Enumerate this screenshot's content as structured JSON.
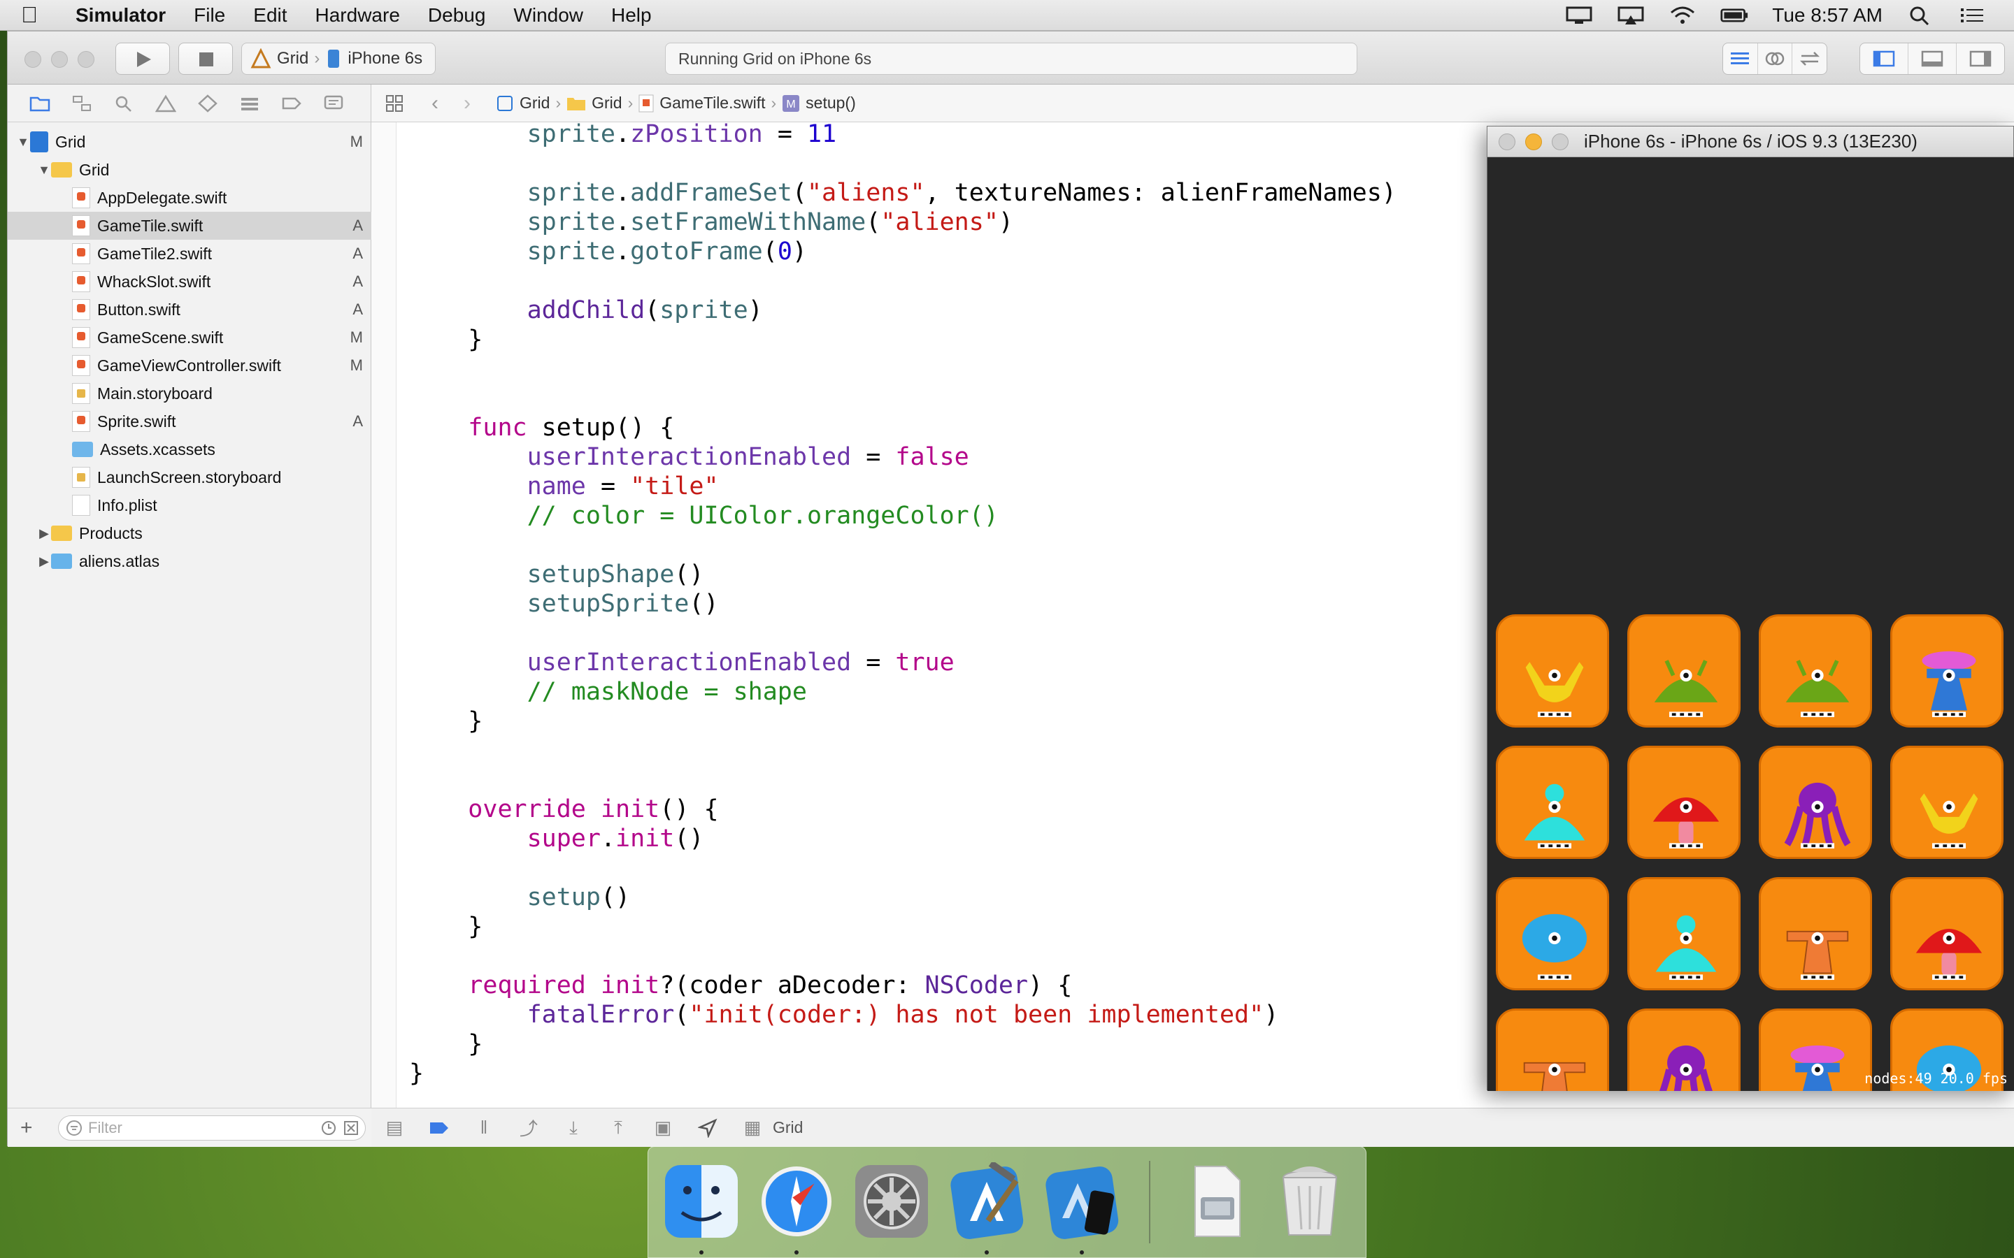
{
  "menubar": {
    "app_name": "Simulator",
    "items": [
      "File",
      "Edit",
      "Hardware",
      "Debug",
      "Window",
      "Help"
    ],
    "clock": "Tue 8:57 AM",
    "battery_icon": "battery-icon",
    "wifi_icon": "wifi-icon"
  },
  "xcode": {
    "scheme": {
      "target": "Grid",
      "device": "iPhone 6s"
    },
    "activity_status": "Running Grid on iPhone 6s",
    "jumpbar": [
      "Grid",
      "Grid",
      "GameTile.swift",
      "setup()"
    ],
    "navigator": {
      "items": [
        {
          "label": "Grid",
          "badge": "M",
          "kind": "project",
          "level": 0,
          "expanded": true
        },
        {
          "label": "Grid",
          "badge": "",
          "kind": "folder",
          "level": 1,
          "expanded": true
        },
        {
          "label": "AppDelegate.swift",
          "badge": "",
          "kind": "swift",
          "level": 2
        },
        {
          "label": "GameTile.swift",
          "badge": "A",
          "kind": "swift",
          "level": 2,
          "selected": true
        },
        {
          "label": "GameTile2.swift",
          "badge": "A",
          "kind": "swift",
          "level": 2
        },
        {
          "label": "WhackSlot.swift",
          "badge": "A",
          "kind": "swift",
          "level": 2
        },
        {
          "label": "Button.swift",
          "badge": "A",
          "kind": "swift",
          "level": 2
        },
        {
          "label": "GameScene.swift",
          "badge": "M",
          "kind": "swift",
          "level": 2
        },
        {
          "label": "GameViewController.swift",
          "badge": "M",
          "kind": "swift",
          "level": 2
        },
        {
          "label": "Main.storyboard",
          "badge": "",
          "kind": "storyboard",
          "level": 2
        },
        {
          "label": "Sprite.swift",
          "badge": "A",
          "kind": "swift",
          "level": 2
        },
        {
          "label": "Assets.xcassets",
          "badge": "",
          "kind": "assets",
          "level": 2
        },
        {
          "label": "LaunchScreen.storyboard",
          "badge": "",
          "kind": "storyboard",
          "level": 2
        },
        {
          "label": "Info.plist",
          "badge": "",
          "kind": "plist",
          "level": 2
        },
        {
          "label": "Products",
          "badge": "",
          "kind": "folder",
          "level": 1,
          "expanded": false
        },
        {
          "label": "aliens.atlas",
          "badge": "",
          "kind": "folder-blue",
          "level": 1,
          "expanded": false
        }
      ],
      "filter_placeholder": "Filter"
    },
    "code_lines": [
      [
        {
          "t": "        "
        },
        {
          "t": "sprite",
          "c": "fn"
        },
        {
          "t": "."
        },
        {
          "t": "zPosition",
          "c": "prop"
        },
        {
          "t": " = "
        },
        {
          "t": "11",
          "c": "num"
        }
      ],
      [],
      [
        {
          "t": "        "
        },
        {
          "t": "sprite",
          "c": "fn"
        },
        {
          "t": "."
        },
        {
          "t": "addFrameSet",
          "c": "fn"
        },
        {
          "t": "("
        },
        {
          "t": "\"aliens\"",
          "c": "str"
        },
        {
          "t": ", textureNames: alienFrameNames)"
        }
      ],
      [
        {
          "t": "        "
        },
        {
          "t": "sprite",
          "c": "fn"
        },
        {
          "t": "."
        },
        {
          "t": "setFrameWithName",
          "c": "fn"
        },
        {
          "t": "("
        },
        {
          "t": "\"aliens\"",
          "c": "str"
        },
        {
          "t": ")"
        }
      ],
      [
        {
          "t": "        "
        },
        {
          "t": "sprite",
          "c": "fn"
        },
        {
          "t": "."
        },
        {
          "t": "gotoFrame",
          "c": "fn"
        },
        {
          "t": "("
        },
        {
          "t": "0",
          "c": "num"
        },
        {
          "t": ")"
        }
      ],
      [],
      [
        {
          "t": "        "
        },
        {
          "t": "addChild",
          "c": "ty"
        },
        {
          "t": "("
        },
        {
          "t": "sprite",
          "c": "fn"
        },
        {
          "t": ")"
        }
      ],
      [
        {
          "t": "    }"
        }
      ],
      [],
      [],
      [
        {
          "t": "    "
        },
        {
          "t": "func",
          "c": "kw"
        },
        {
          "t": " setup() {"
        }
      ],
      [
        {
          "t": "        "
        },
        {
          "t": "userInteractionEnabled",
          "c": "prop"
        },
        {
          "t": " = "
        },
        {
          "t": "false",
          "c": "kw"
        }
      ],
      [
        {
          "t": "        "
        },
        {
          "t": "name",
          "c": "prop"
        },
        {
          "t": " = "
        },
        {
          "t": "\"tile\"",
          "c": "str"
        }
      ],
      [
        {
          "t": "        "
        },
        {
          "t": "// color = UIColor.orangeColor()",
          "c": "cm"
        }
      ],
      [],
      [
        {
          "t": "        "
        },
        {
          "t": "setupShape",
          "c": "fn"
        },
        {
          "t": "()"
        }
      ],
      [
        {
          "t": "        "
        },
        {
          "t": "setupSprite",
          "c": "fn"
        },
        {
          "t": "()"
        }
      ],
      [],
      [
        {
          "t": "        "
        },
        {
          "t": "userInteractionEnabled",
          "c": "prop"
        },
        {
          "t": " = "
        },
        {
          "t": "true",
          "c": "kw"
        }
      ],
      [
        {
          "t": "        "
        },
        {
          "t": "// maskNode = shape",
          "c": "cm"
        }
      ],
      [
        {
          "t": "    }"
        }
      ],
      [],
      [],
      [
        {
          "t": "    "
        },
        {
          "t": "override",
          "c": "kw"
        },
        {
          "t": " "
        },
        {
          "t": "init",
          "c": "kw"
        },
        {
          "t": "() {"
        }
      ],
      [
        {
          "t": "        "
        },
        {
          "t": "super",
          "c": "kw"
        },
        {
          "t": "."
        },
        {
          "t": "init",
          "c": "kw"
        },
        {
          "t": "()"
        }
      ],
      [],
      [
        {
          "t": "        "
        },
        {
          "t": "setup",
          "c": "fn"
        },
        {
          "t": "()"
        }
      ],
      [
        {
          "t": "    }"
        }
      ],
      [],
      [
        {
          "t": "    "
        },
        {
          "t": "required",
          "c": "kw"
        },
        {
          "t": " "
        },
        {
          "t": "init",
          "c": "kw"
        },
        {
          "t": "?(coder aDecoder: "
        },
        {
          "t": "NSCoder",
          "c": "ty"
        },
        {
          "t": ") {"
        }
      ],
      [
        {
          "t": "        "
        },
        {
          "t": "fatalError",
          "c": "ty"
        },
        {
          "t": "("
        },
        {
          "t": "\"init(coder:) has not been implemented\"",
          "c": "str"
        },
        {
          "t": ")"
        }
      ],
      [
        {
          "t": "    }"
        }
      ],
      [
        {
          "t": "}"
        }
      ]
    ],
    "debugbar": {
      "target": "Grid"
    }
  },
  "simulator": {
    "title": "iPhone 6s - iPhone 6s / iOS 9.3 (13E230)",
    "stats": "nodes:49  20.0 fps",
    "grid": [
      [
        "yellow-antenna-alien",
        "green-slug-alien",
        "green-slug-alien",
        "pink-brain-alien"
      ],
      [
        "cyan-eye-alien",
        "red-mushroom-alien",
        "purple-tentacle-alien",
        "yellow-antenna-alien"
      ],
      [
        "blue-skull-alien",
        "cyan-eye-alien",
        "orange-stalk-alien",
        "red-mushroom-alien"
      ],
      [
        "orange-stalk-alien",
        "purple-tentacle-alien",
        "pink-brain-alien",
        "blue-skull-alien"
      ]
    ]
  },
  "dock": {
    "apps": [
      "finder-icon",
      "safari-icon",
      "system-preferences-icon",
      "xcode-icon",
      "simulator-icon",
      "files-icon",
      "trash-icon"
    ]
  },
  "colors": {
    "tile_orange": "#f78a0f",
    "keyword": "#b3068a",
    "string": "#c41a16",
    "comment": "#238b21"
  }
}
